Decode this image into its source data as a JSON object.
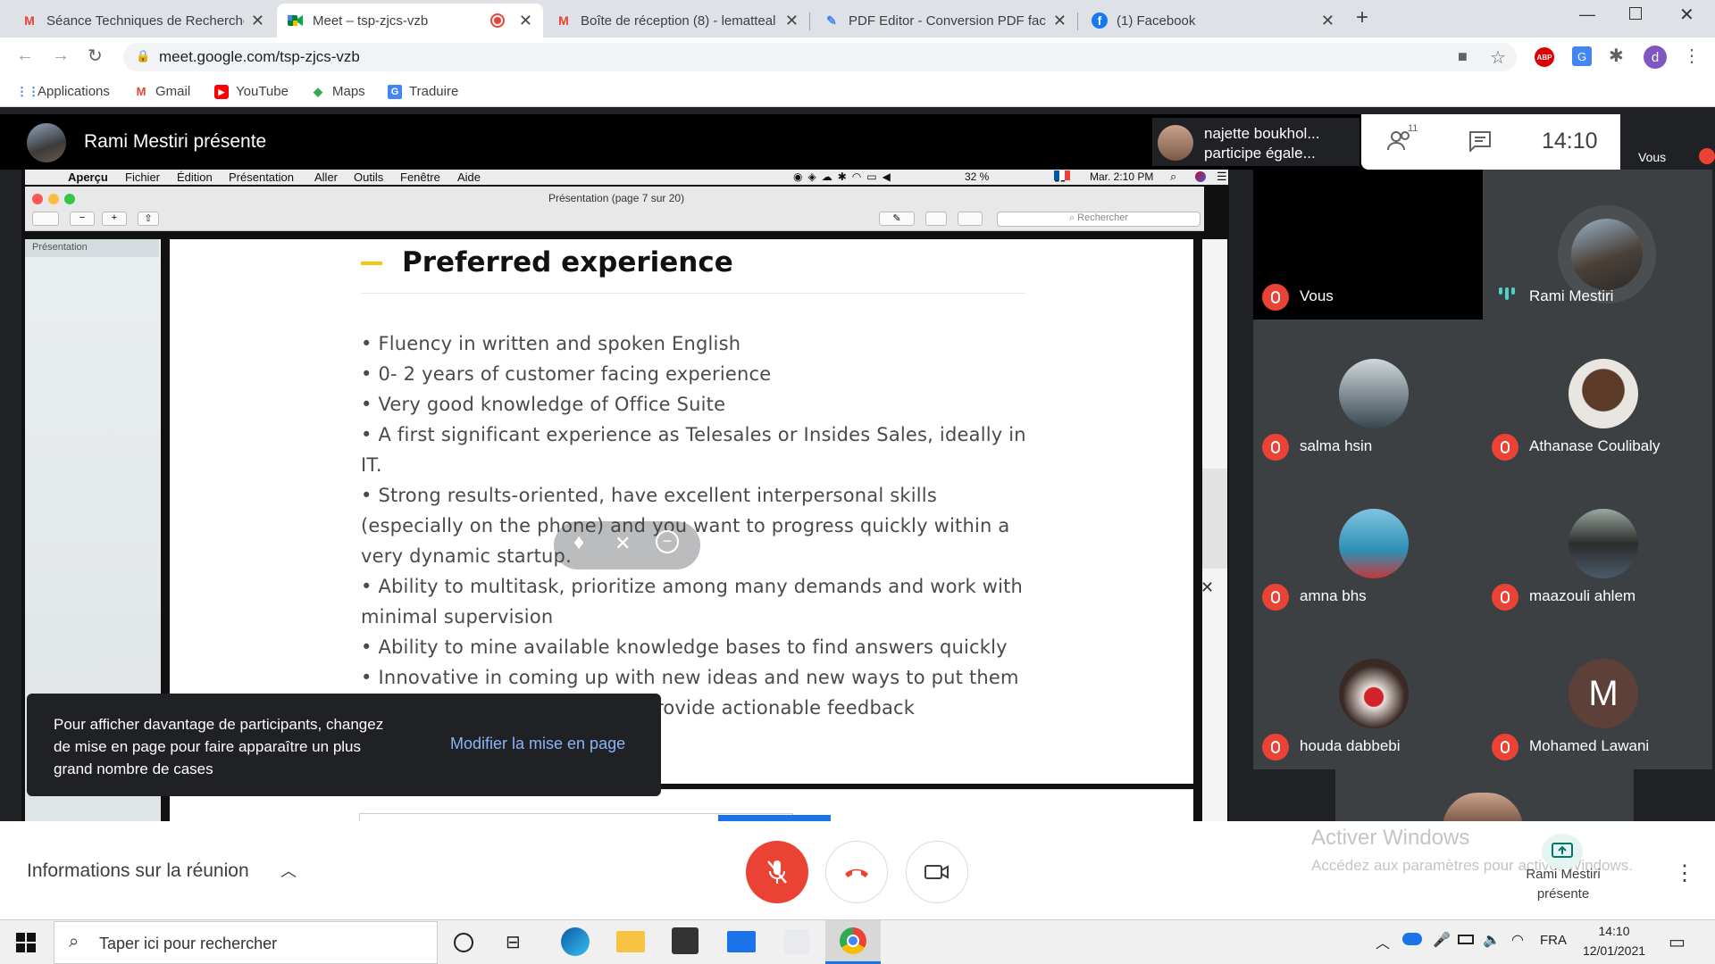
{
  "browser": {
    "tabs": [
      {
        "title": "Séance Techniques de Recherche",
        "icon": "gmail-icon"
      },
      {
        "title": "Meet – tsp-zjcs-vzb",
        "icon": "meet-icon"
      },
      {
        "title": "Boîte de réception (8) - lematteal",
        "icon": "gmail-icon"
      },
      {
        "title": "PDF Editor - Conversion PDF facil",
        "icon": "pdf-editor-icon"
      },
      {
        "title": "(1) Facebook",
        "icon": "facebook-icon"
      }
    ],
    "url": "meet.google.com/tsp-zjcs-vzb",
    "profile_initial": "d",
    "abp_label": "ABP",
    "bookmarks": [
      "Applications",
      "Gmail",
      "YouTube",
      "Maps",
      "Traduire"
    ]
  },
  "meet": {
    "presenter_title": "Rami Mestiri présente",
    "top_participant": {
      "name": "najette boukhol...",
      "status": "participe égale..."
    },
    "participant_count": "11",
    "clock": "14:10",
    "self_label": "Vous",
    "participants": [
      {
        "name": "Vous"
      },
      {
        "name": "Rami Mestiri"
      },
      {
        "name": "salma hsin"
      },
      {
        "name": "Athanase Coulibaly"
      },
      {
        "name": "amna bhs"
      },
      {
        "name": "maazouli ahlem"
      },
      {
        "name": "houda dabbebi"
      },
      {
        "name": "Mohamed Lawani",
        "initial": "M"
      }
    ],
    "toast": {
      "message": "Pour afficher davantage de participants, changez de mise en page pour faire apparaître un plus grand nombre de cases",
      "action": "Modifier la mise en page"
    },
    "meeting_info": "Informations sur la réunion",
    "presenting_line1": "Rami Mestiri",
    "presenting_line2": "présente",
    "watermark_title": "Activer Windows",
    "watermark_sub": "Accédez aux paramètres pour activer Windows."
  },
  "mac": {
    "menu": [
      "Aperçu",
      "Fichier",
      "Édition",
      "Présentation",
      "Aller",
      "Outils",
      "Fenêtre",
      "Aide"
    ],
    "battery": "32 %",
    "datetime": "Mar. 2:10 PM",
    "window_title": "Présentation (page 7 sur 20)",
    "sidebar_label": "Présentation",
    "search_placeholder": "Rechercher"
  },
  "slide": {
    "title": "Preferred experience",
    "accent_color": "#f5c518",
    "bullets": [
      "• Fluency in written and spoken English",
      "• 0- 2 years of customer facing experience",
      "• Very good knowledge of Office Suite",
      "• A first significant experience as Telesales or Insides Sales, ideally in",
      "IT.",
      "• Strong results-oriented, have excellent interpersonal skills",
      "(especially on the phone) and you want to progress quickly within a",
      "very dynamic startup.",
      "• Ability to multitask, prioritize among many demands and work with",
      "minimal supervision",
      "• Ability to mine available knowledge bases to find answers quickly",
      "• Innovative in coming up with new ideas and new ways to put them",
      "rovide actionable feedback"
    ]
  },
  "taskbar": {
    "search_placeholder": "Taper ici pour rechercher",
    "lang": "FRA",
    "time": "14:10",
    "date": "12/01/2021"
  },
  "colors": {
    "meet_red": "#ea4335",
    "accent_teal": "#1a73e8"
  }
}
